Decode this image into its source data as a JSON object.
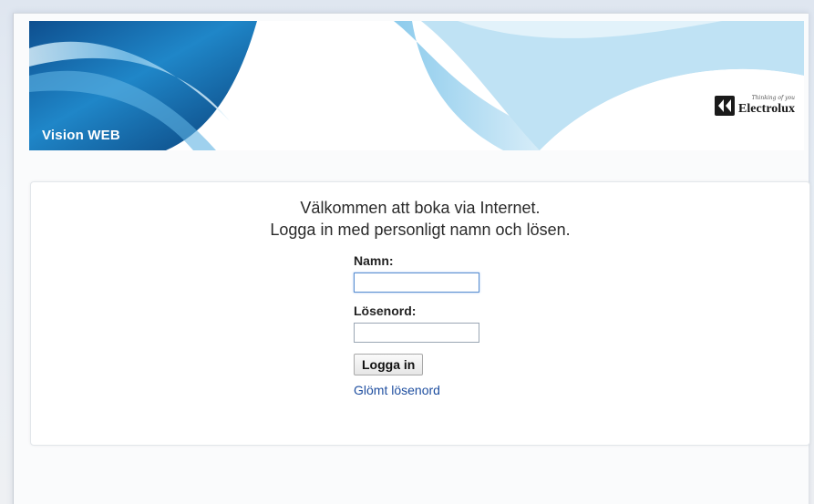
{
  "banner": {
    "title": "Vision WEB",
    "brand_tagline": "Thinking of you",
    "brand_name": "Electrolux"
  },
  "login": {
    "welcome_line1": "Välkommen att boka via Internet.",
    "welcome_line2": "Logga in med personligt namn och lösen.",
    "name_label": "Namn:",
    "name_value": "",
    "password_label": "Lösenord:",
    "password_value": "",
    "submit_label": "Logga in",
    "forgot_link": "Glömt lösenord"
  },
  "colors": {
    "banner_blue": "#1b6fb3",
    "link": "#1f4fa0"
  }
}
